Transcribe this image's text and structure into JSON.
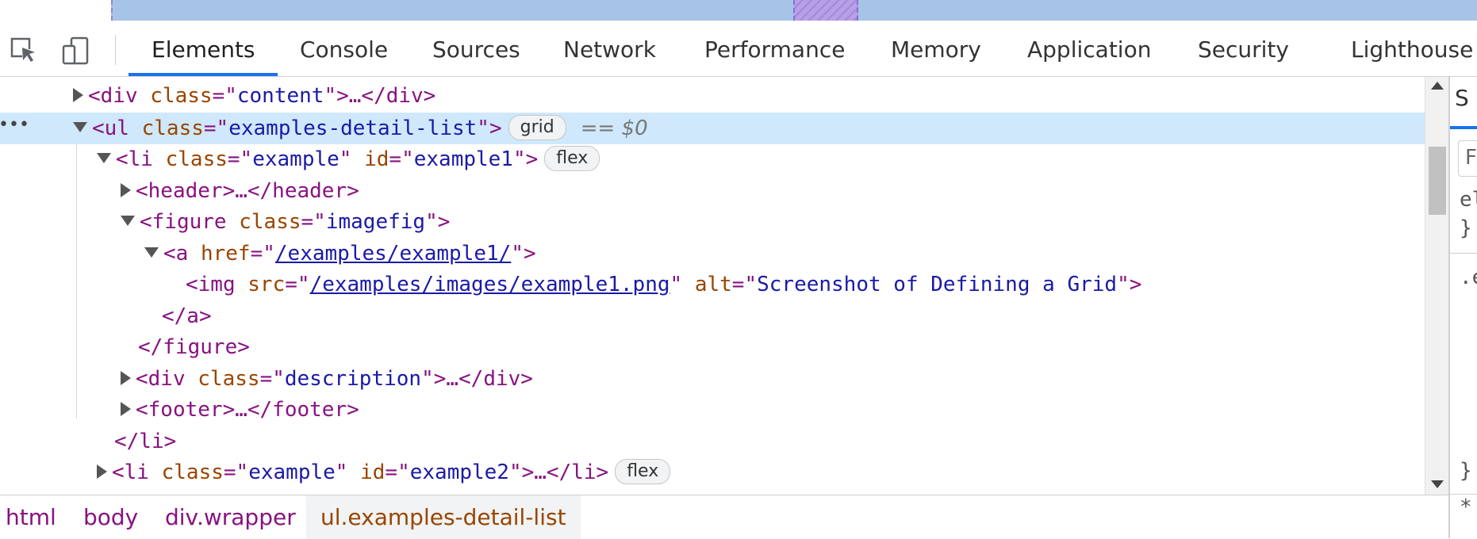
{
  "toolbar": {
    "tabs": [
      "Elements",
      "Console",
      "Sources",
      "Network",
      "Performance",
      "Memory",
      "Application",
      "Security",
      "Lighthouse"
    ],
    "active_tab": "Elements"
  },
  "tree": {
    "r0": {
      "tag_open": "<div",
      "attr": "class",
      "val": "content",
      "tail": ">…</div>"
    },
    "r1": {
      "tag_open": "<ul",
      "attr": "class",
      "val": "examples-detail-list",
      "tail": ">",
      "badge": "grid",
      "eq": "== $0"
    },
    "r2": {
      "tag_open": "<li",
      "attr1": "class",
      "val1": "example",
      "attr2": "id",
      "val2": "example1",
      "tail": ">",
      "badge": "flex"
    },
    "r3": {
      "text": "<header>…</header>"
    },
    "r4": {
      "tag_open": "<figure",
      "attr": "class",
      "val": "imagefig",
      "tail": ">"
    },
    "r5": {
      "tag_open": "<a",
      "attr": "href",
      "val": "/examples/example1/",
      "tail": ">"
    },
    "r6": {
      "tag_open": "<img",
      "attr1": "src",
      "val1": "/examples/images/example1.png",
      "attr2": "alt",
      "val2": "Screenshot of Defining a Grid",
      "tail": ">"
    },
    "r7": {
      "text": "</a>"
    },
    "r8": {
      "text": "</figure>"
    },
    "r9": {
      "tag_open": "<div",
      "attr": "class",
      "val": "description",
      "tail": ">…</div>"
    },
    "r10": {
      "text": "<footer>…</footer>"
    },
    "r11": {
      "text": "</li>"
    },
    "r12": {
      "tag_open": "<li",
      "attr1": "class",
      "val1": "example",
      "attr2": "id",
      "val2": "example2",
      "tail": ">…</li>",
      "badge": "flex"
    }
  },
  "breadcrumbs": [
    "html",
    "body",
    "div.wrapper",
    "ul.examples-detail-list"
  ],
  "styles_pane": {
    "tab_letter": "S",
    "filter_letter": "F",
    "line1": "el",
    "line2": "}",
    "line3": ".e",
    "line4": "}",
    "line5": "*"
  },
  "colors": {
    "accent": "#1a73e8",
    "selected_row": "#cfe8fc",
    "tag": "#881280",
    "attr_name": "#994500",
    "attr_value": "#1a1aa6"
  }
}
